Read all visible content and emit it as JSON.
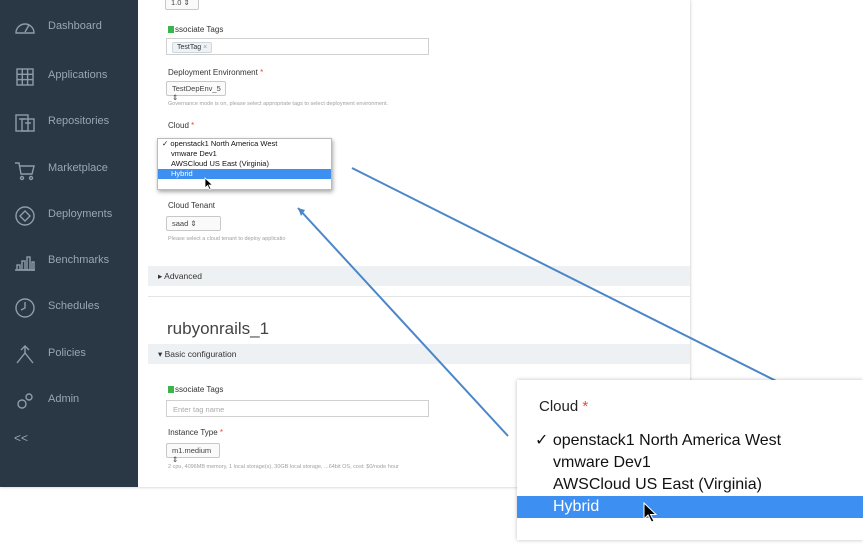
{
  "sidebar": {
    "items": [
      {
        "label": "Dashboard",
        "icon": "dashboard-icon"
      },
      {
        "label": "Applications",
        "icon": "applications-grid-icon"
      },
      {
        "label": "Repositories",
        "icon": "repositories-icon"
      },
      {
        "label": "Marketplace",
        "icon": "cart-icon"
      },
      {
        "label": "Deployments",
        "icon": "deployments-icon"
      },
      {
        "label": "Benchmarks",
        "icon": "benchmarks-icon"
      },
      {
        "label": "Schedules",
        "icon": "clock-icon"
      },
      {
        "label": "Policies",
        "icon": "policies-icon"
      },
      {
        "label": "Admin",
        "icon": "admin-gear-icon"
      }
    ],
    "collapse_label": "<<"
  },
  "top": {
    "count_select": "1.0 ⇕",
    "associate_tags_label": "ssociate Tags",
    "tag_value": "TestTag",
    "tag_remove": "×",
    "deploy_env_label": "Deployment Environment",
    "required_mark": "*",
    "deploy_env_value": "TestDepEnv_5  ⇕",
    "governance_hint": "Governance mode is on, please select appropriate tags to select deployment environment.",
    "cloud_label": "Cloud",
    "cloud_options": [
      "openstack1 North America West",
      "vmware Dev1",
      "AWSCloud US East (Virginia)",
      "Hybrid"
    ],
    "cloud_selected_mark": "✓",
    "cloud_tenant_label": "Cloud Tenant",
    "cloud_tenant_value": "saad   ⇕",
    "cloud_tenant_hint": "Please select a cloud tenant to deploy applicatio",
    "advanced_label": "▸ Advanced"
  },
  "section2": {
    "title": "rubyonrails_1",
    "basic_config_label": "▾ Basic configuration",
    "associate_tags_label": "ssociate Tags",
    "tag_placeholder": "Enter tag name",
    "instance_type_label": "Instance Type",
    "instance_type_value": "m1.medium  ⇕",
    "instance_hint": "2 cpu, 4096MB memory, 1 local storage(s), 30GB local storage, ...64bit OS, cost: $0/node hour"
  },
  "zoom": {
    "cloud_label": "Cloud",
    "required_mark": "*",
    "selected_mark": "✓",
    "options": [
      "openstack1 North America West",
      "vmware Dev1",
      "AWSCloud US East (Virginia)",
      "Hybrid"
    ]
  },
  "colors": {
    "sidebar": "#2a3744",
    "highlight": "#3d8ff1",
    "arrow": "#4a86c8",
    "tag_green": "#3cb44b"
  }
}
